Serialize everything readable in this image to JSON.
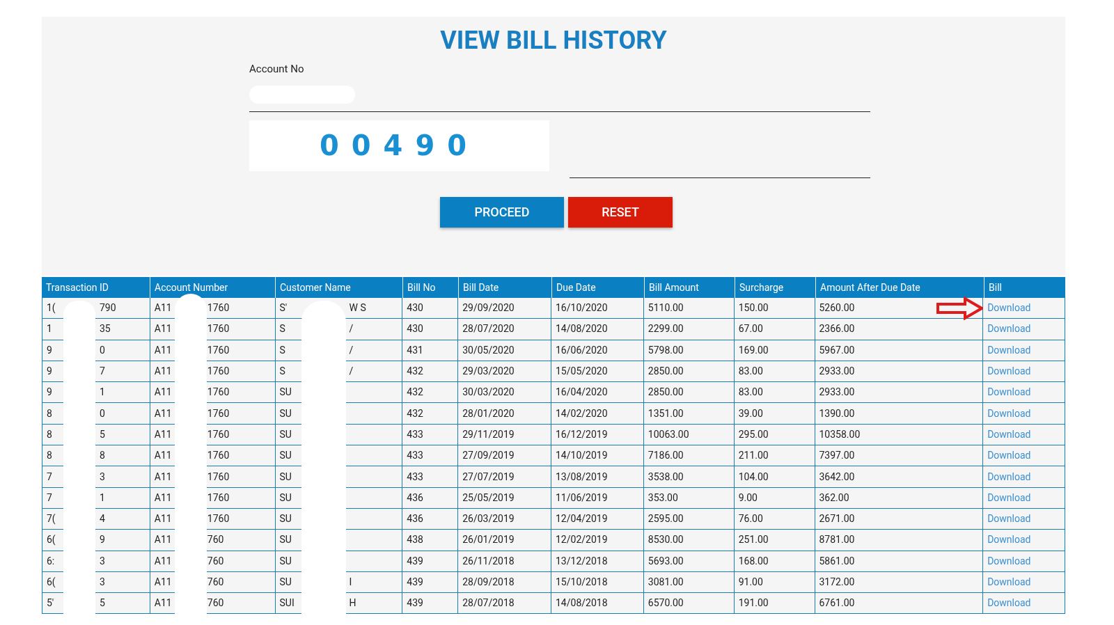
{
  "title": "VIEW BILL HISTORY",
  "form": {
    "account_label": "Account No",
    "captcha": "00490",
    "buttons": [
      {
        "label": "PROCEED",
        "kind": "primary"
      },
      {
        "label": "RESET",
        "kind": "danger"
      }
    ]
  },
  "table": {
    "columns": [
      "Transaction ID",
      "Account Number",
      "Customer Name",
      "Bill No",
      "Bill Date",
      "Due Date",
      "Bill Amount",
      "Surcharge",
      "Amount After Due Date",
      "Bill"
    ],
    "rows": [
      {
        "transaction_id": [
          "1(",
          "790"
        ],
        "account_number": [
          "A11",
          "1760"
        ],
        "customer_name": [
          "S'",
          "W S"
        ],
        "bill_no": "430",
        "bill_date": "29/09/2020",
        "due_date": "16/10/2020",
        "bill_amount": "5110.00",
        "surcharge": "150.00",
        "amount_after_due": "5260.00",
        "bill": "Download",
        "marked": true
      },
      {
        "transaction_id": [
          "1",
          "35"
        ],
        "account_number": [
          "A11",
          "1760"
        ],
        "customer_name": [
          "S",
          "/"
        ],
        "bill_no": "430",
        "bill_date": "28/07/2020",
        "due_date": "14/08/2020",
        "bill_amount": "2299.00",
        "surcharge": "67.00",
        "amount_after_due": "2366.00",
        "bill": "Download",
        "marked": false
      },
      {
        "transaction_id": [
          "9",
          "0"
        ],
        "account_number": [
          "A11",
          "1760"
        ],
        "customer_name": [
          "S",
          "/"
        ],
        "bill_no": "431",
        "bill_date": "30/05/2020",
        "due_date": "16/06/2020",
        "bill_amount": "5798.00",
        "surcharge": "169.00",
        "amount_after_due": "5967.00",
        "bill": "Download",
        "marked": false
      },
      {
        "transaction_id": [
          "9",
          "7"
        ],
        "account_number": [
          "A11",
          "1760"
        ],
        "customer_name": [
          "S",
          "/"
        ],
        "bill_no": "432",
        "bill_date": "29/03/2020",
        "due_date": "15/05/2020",
        "bill_amount": "2850.00",
        "surcharge": "83.00",
        "amount_after_due": "2933.00",
        "bill": "Download",
        "marked": false
      },
      {
        "transaction_id": [
          "9",
          "1"
        ],
        "account_number": [
          "A11",
          "1760"
        ],
        "customer_name": [
          "SU"
        ],
        "bill_no": "432",
        "bill_date": "30/03/2020",
        "due_date": "16/04/2020",
        "bill_amount": "2850.00",
        "surcharge": "83.00",
        "amount_after_due": "2933.00",
        "bill": "Download",
        "marked": false
      },
      {
        "transaction_id": [
          "8",
          "0"
        ],
        "account_number": [
          "A11",
          "1760"
        ],
        "customer_name": [
          "SU"
        ],
        "bill_no": "432",
        "bill_date": "28/01/2020",
        "due_date": "14/02/2020",
        "bill_amount": "1351.00",
        "surcharge": "39.00",
        "amount_after_due": "1390.00",
        "bill": "Download",
        "marked": false
      },
      {
        "transaction_id": [
          "8",
          "5"
        ],
        "account_number": [
          "A11",
          "1760"
        ],
        "customer_name": [
          "SU"
        ],
        "bill_no": "433",
        "bill_date": "29/11/2019",
        "due_date": "16/12/2019",
        "bill_amount": "10063.00",
        "surcharge": "295.00",
        "amount_after_due": "10358.00",
        "bill": "Download",
        "marked": false
      },
      {
        "transaction_id": [
          "8",
          "8"
        ],
        "account_number": [
          "A11",
          "1760"
        ],
        "customer_name": [
          "SU"
        ],
        "bill_no": "433",
        "bill_date": "27/09/2019",
        "due_date": "14/10/2019",
        "bill_amount": "7186.00",
        "surcharge": "211.00",
        "amount_after_due": "7397.00",
        "bill": "Download",
        "marked": false
      },
      {
        "transaction_id": [
          "7",
          "3"
        ],
        "account_number": [
          "A11",
          "1760"
        ],
        "customer_name": [
          "SU"
        ],
        "bill_no": "433",
        "bill_date": "27/07/2019",
        "due_date": "13/08/2019",
        "bill_amount": "3538.00",
        "surcharge": "104.00",
        "amount_after_due": "3642.00",
        "bill": "Download",
        "marked": false
      },
      {
        "transaction_id": [
          "7",
          "1"
        ],
        "account_number": [
          "A11",
          "1760"
        ],
        "customer_name": [
          "SU"
        ],
        "bill_no": "436",
        "bill_date": "25/05/2019",
        "due_date": "11/06/2019",
        "bill_amount": "353.00",
        "surcharge": "9.00",
        "amount_after_due": "362.00",
        "bill": "Download",
        "marked": false
      },
      {
        "transaction_id": [
          "7(",
          "4"
        ],
        "account_number": [
          "A11",
          "1760"
        ],
        "customer_name": [
          "SU"
        ],
        "bill_no": "436",
        "bill_date": "26/03/2019",
        "due_date": "12/04/2019",
        "bill_amount": "2595.00",
        "surcharge": "76.00",
        "amount_after_due": "2671.00",
        "bill": "Download",
        "marked": false
      },
      {
        "transaction_id": [
          "6(",
          "9"
        ],
        "account_number": [
          "A11",
          "760"
        ],
        "customer_name": [
          "SU"
        ],
        "bill_no": "438",
        "bill_date": "26/01/2019",
        "due_date": "12/02/2019",
        "bill_amount": "8530.00",
        "surcharge": "251.00",
        "amount_after_due": "8781.00",
        "bill": "Download",
        "marked": false
      },
      {
        "transaction_id": [
          "6:",
          "3"
        ],
        "account_number": [
          "A11",
          "760"
        ],
        "customer_name": [
          "SU"
        ],
        "bill_no": "439",
        "bill_date": "26/11/2018",
        "due_date": "13/12/2018",
        "bill_amount": "5693.00",
        "surcharge": "168.00",
        "amount_after_due": "5861.00",
        "bill": "Download",
        "marked": false
      },
      {
        "transaction_id": [
          "6(",
          "3"
        ],
        "account_number": [
          "A11",
          "760"
        ],
        "customer_name": [
          "SU",
          "I"
        ],
        "bill_no": "439",
        "bill_date": "28/09/2018",
        "due_date": "15/10/2018",
        "bill_amount": "3081.00",
        "surcharge": "91.00",
        "amount_after_due": "3172.00",
        "bill": "Download",
        "marked": false
      },
      {
        "transaction_id": [
          "5'",
          "5"
        ],
        "account_number": [
          "A11",
          "760"
        ],
        "customer_name": [
          "SUI",
          "H"
        ],
        "bill_no": "439",
        "bill_date": "28/07/2018",
        "due_date": "14/08/2018",
        "bill_amount": "6570.00",
        "surcharge": "191.00",
        "amount_after_due": "6761.00",
        "bill": "Download",
        "marked": false
      }
    ]
  }
}
